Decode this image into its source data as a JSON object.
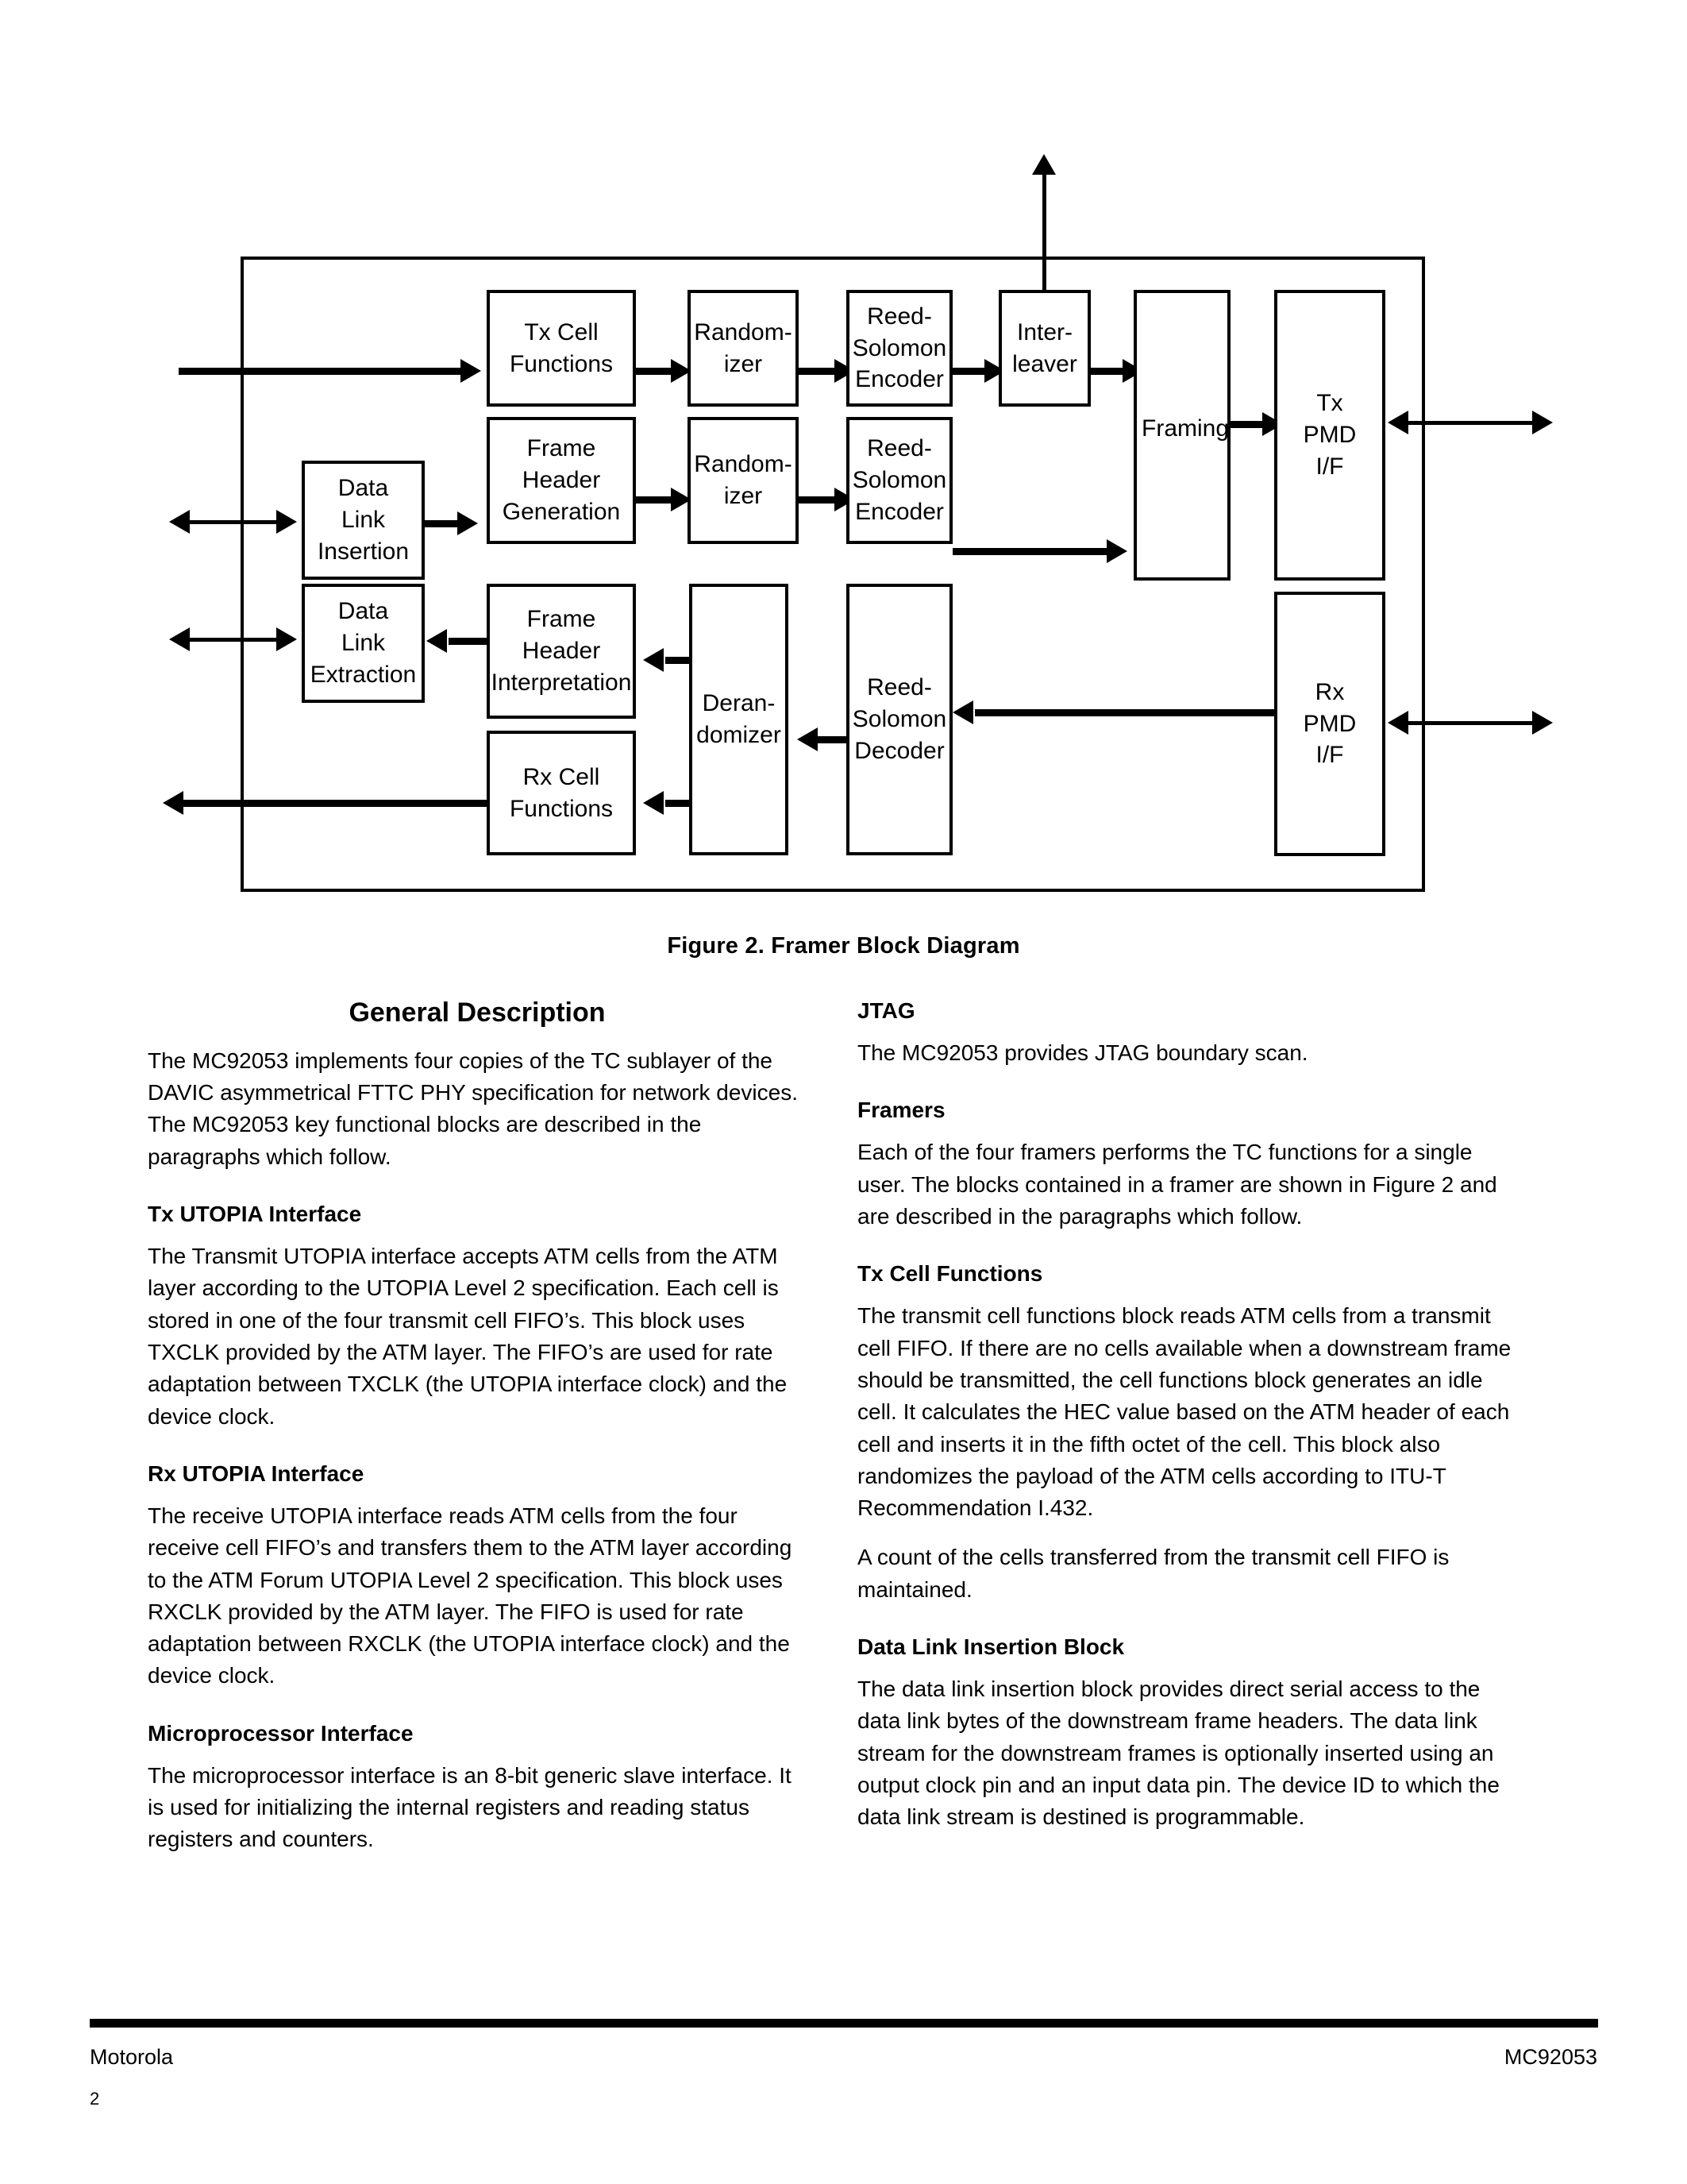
{
  "figure": {
    "caption": "Figure 2.  Framer Block Diagram",
    "blocks": {
      "tx_cell_functions": "Tx Cell\nFunctions",
      "randomizer_1": "Random-\nizer",
      "rs_encoder_1": "Reed-\nSolomon\nEncoder",
      "interleaver": "Inter-\nleaver",
      "framing": "Framing",
      "tx_pmd_if": "Tx\nPMD\nI/F",
      "data_link_insertion": "Data\nLink\nInsertion",
      "frame_header_generation": "Frame\nHeader\nGeneration",
      "randomizer_2": "Random-\nizer",
      "rs_encoder_2": "Reed-\nSolomon\nEncoder",
      "data_link_extraction": "Data\nLink\nExtraction",
      "frame_header_interpretation": "Frame\nHeader\nInterpretation",
      "derandomizer": "Deran-\ndomizer",
      "rs_decoder": "Reed-\nSolomon\nDecoder",
      "rx_cell_functions": "Rx Cell\nFunctions",
      "rx_pmd_if": "Rx\nPMD\nI/F"
    }
  },
  "left_column": {
    "title": "General Description",
    "intro": "The MC92053 implements four copies of the TC sublayer of the DAVIC asymmetrical FTTC PHY specification for network devices. The MC92053 key functional blocks are described in the paragraphs which follow.",
    "sections": [
      {
        "heading": "Tx UTOPIA Interface",
        "body": "The Transmit UTOPIA interface accepts ATM cells from the ATM layer according to the UTOPIA Level 2 specification. Each cell is stored in one of the four transmit cell FIFO’s. This block uses TXCLK provided by the ATM layer. The FIFO’s are used for rate adaptation between TXCLK (the UTOPIA interface clock) and the device clock."
      },
      {
        "heading": "Rx UTOPIA Interface",
        "body": "The receive UTOPIA interface reads ATM cells from the four receive cell FIFO’s and transfers them to the ATM layer according to the ATM Forum UTOPIA Level 2 specification. This block uses RXCLK provided by the ATM layer. The FIFO is used for rate adaptation between RXCLK (the UTOPIA interface clock) and the device clock."
      },
      {
        "heading": "Microprocessor Interface",
        "body": "The microprocessor interface is an 8-bit generic slave interface. It is used for initializing the internal registers and reading status registers and counters."
      }
    ]
  },
  "right_column": {
    "sections": [
      {
        "heading": "JTAG",
        "body": "The MC92053 provides JTAG boundary scan."
      },
      {
        "heading": "Framers",
        "body": "Each of the four framers performs the TC functions for a single user. The blocks contained in a framer are shown in Figure 2 and are described in the paragraphs which follow."
      },
      {
        "heading": "Tx Cell Functions",
        "body": "The transmit cell functions block reads ATM cells from a transmit cell FIFO. If there are no cells available when a downstream frame should be transmitted, the cell functions block generates an idle cell. It calculates the HEC value based on the ATM header of each cell and inserts it in the fifth octet of the cell. This block also randomizes the payload of the ATM cells according to ITU-T Recommendation I.432.",
        "body2": "A count of the cells transferred from the transmit cell FIFO is maintained."
      },
      {
        "heading": "Data Link Insertion Block",
        "body": "The data link insertion block provides direct serial access to the data link bytes of the downstream frame headers. The data link stream for the downstream frames is optionally inserted using an output clock pin and an input data pin. The device ID to which the data link stream is destined is programmable."
      }
    ]
  },
  "footer": {
    "left": "Motorola",
    "right": "MC92053",
    "page_number": "2"
  }
}
